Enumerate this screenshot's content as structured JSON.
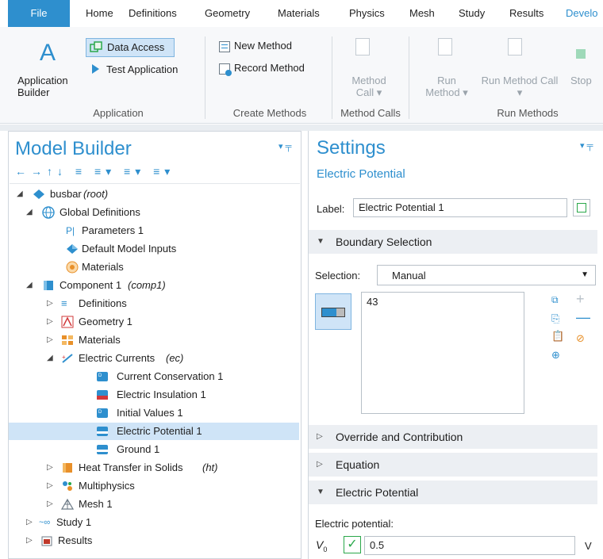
{
  "tabs": [
    "File",
    "Home",
    "Definitions",
    "Geometry",
    "Materials",
    "Physics",
    "Mesh",
    "Study",
    "Results",
    "Develo"
  ],
  "ribbon": {
    "app_builder": "Application Builder",
    "data_access": "Data Access",
    "test_app": "Test Application",
    "new_method": "New Method",
    "record_method": "Record Method",
    "method_call": "Method Call",
    "run_method": "Run Method",
    "run_method_call": "Run Method Call",
    "stop": "Stop",
    "groups": [
      "Application",
      "Create Methods",
      "Method Calls",
      "Run Methods"
    ]
  },
  "model_builder": {
    "title": "Model Builder",
    "tree": [
      {
        "label": "busbar",
        "suffix": "(root)"
      },
      {
        "label": "Global Definitions"
      },
      {
        "label": "Parameters 1"
      },
      {
        "label": "Default Model Inputs"
      },
      {
        "label": "Materials"
      },
      {
        "label": "Component 1",
        "suffix": "(comp1)"
      },
      {
        "label": "Definitions"
      },
      {
        "label": "Geometry 1"
      },
      {
        "label": "Materials"
      },
      {
        "label": "Electric Currents",
        "suffix": "(ec)"
      },
      {
        "label": "Current Conservation 1"
      },
      {
        "label": "Electric Insulation 1"
      },
      {
        "label": "Initial Values 1"
      },
      {
        "label": "Electric Potential 1"
      },
      {
        "label": "Ground 1"
      },
      {
        "label": "Heat Transfer in Solids",
        "suffix": "(ht)"
      },
      {
        "label": "Multiphysics"
      },
      {
        "label": "Mesh 1"
      },
      {
        "label": "Study 1"
      },
      {
        "label": "Results"
      }
    ]
  },
  "settings": {
    "title": "Settings",
    "subtitle": "Electric Potential",
    "label_caption": "Label:",
    "label_value": "Electric Potential 1",
    "boundary_selection": "Boundary Selection",
    "selection_caption": "Selection:",
    "selection_value": "Manual",
    "selection_list": [
      "43"
    ],
    "override": "Override and Contribution",
    "equation": "Equation",
    "electric_potential": "Electric Potential",
    "potential_caption": "Electric potential:",
    "v0_symbol": "V",
    "v0_sub": "0",
    "v0_value": "0.5",
    "v0_unit": "V"
  },
  "colors": {
    "accent": "#2e8fce",
    "selected_row": "#cfe4f7",
    "section_bg": "#eceff3"
  }
}
